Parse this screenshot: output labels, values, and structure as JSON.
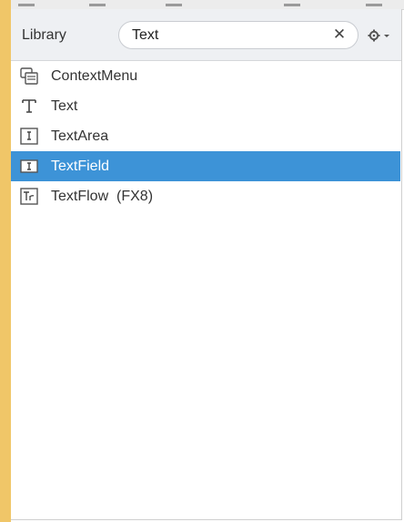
{
  "header": {
    "title": "Library"
  },
  "search": {
    "value": "Text",
    "clear_symbol": "✕"
  },
  "settings_icon": "gear-icon",
  "colors": {
    "accent_bar": "#f0c668",
    "selection": "#3d93d7"
  },
  "items": [
    {
      "label": "ContextMenu",
      "icon": "context-menu-icon",
      "selected": false
    },
    {
      "label": "Text",
      "icon": "text-icon",
      "selected": false
    },
    {
      "label": "TextArea",
      "icon": "text-area-icon",
      "selected": false
    },
    {
      "label": "TextField",
      "icon": "text-field-icon",
      "selected": true
    },
    {
      "label": "TextFlow  (FX8)",
      "icon": "text-flow-icon",
      "selected": false
    }
  ]
}
